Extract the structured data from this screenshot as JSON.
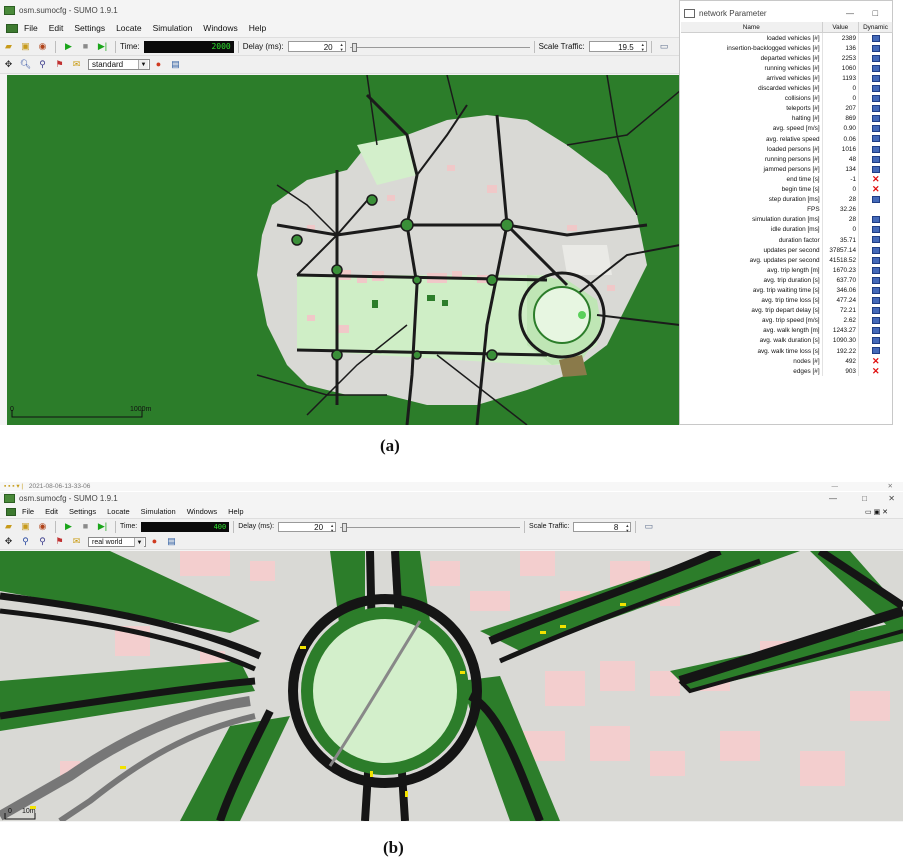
{
  "colors": {
    "grass": "#2c7d2a",
    "road": "#1b1b1b",
    "landuse": "#d6d6d2",
    "park": "#cfeec6",
    "building": "#f0c8c8",
    "time_text": "#2de02d",
    "dyn_plot": "#4469b8",
    "dyn_x": "#e01010"
  },
  "panel_a": {
    "title": "osm.sumocfg - SUMO 1.9.1",
    "menu": [
      "File",
      "Edit",
      "Settings",
      "Locate",
      "Simulation",
      "Windows",
      "Help"
    ],
    "toolbar": {
      "time_label": "Time:",
      "time_value": "2000",
      "delay_label": "Delay (ms):",
      "delay_value": "20",
      "scale_label": "Scale Traffic:",
      "scale_value": "19.5"
    },
    "view_selector": "standard",
    "scale_bar": {
      "start": "0",
      "end": "1000m"
    },
    "icons": [
      "open-icon",
      "reload-icon",
      "close-icon",
      "play-icon",
      "stop-icon",
      "step-icon",
      "locate-icon",
      "zoom-icon",
      "vehicle-locate-icon",
      "lock-icon",
      "speech-icon",
      "color-wheel-icon",
      "screenshot-icon"
    ]
  },
  "param_window": {
    "title": "network Parameter",
    "columns": [
      "Name",
      "Value",
      "Dynamic"
    ],
    "rows": [
      {
        "name": "loaded vehicles [#]",
        "value": "2389",
        "dyn": "plot"
      },
      {
        "name": "insertion-backlogged vehicles [#]",
        "value": "136",
        "dyn": "plot"
      },
      {
        "name": "departed vehicles [#]",
        "value": "2253",
        "dyn": "plot"
      },
      {
        "name": "running vehicles [#]",
        "value": "1060",
        "dyn": "plot"
      },
      {
        "name": "arrived vehicles [#]",
        "value": "1193",
        "dyn": "plot"
      },
      {
        "name": "discarded vehicles [#]",
        "value": "0",
        "dyn": "plot"
      },
      {
        "name": "collisions [#]",
        "value": "0",
        "dyn": "plot"
      },
      {
        "name": "teleports [#]",
        "value": "207",
        "dyn": "plot"
      },
      {
        "name": "halting [#]",
        "value": "869",
        "dyn": "plot"
      },
      {
        "name": "avg. speed [m/s]",
        "value": "0.90",
        "dyn": "plot"
      },
      {
        "name": "avg. relative speed",
        "value": "0.06",
        "dyn": "plot"
      },
      {
        "name": "loaded persons [#]",
        "value": "1016",
        "dyn": "plot"
      },
      {
        "name": "running persons [#]",
        "value": "48",
        "dyn": "plot"
      },
      {
        "name": "jammed persons [#]",
        "value": "134",
        "dyn": "plot"
      },
      {
        "name": "end time [s]",
        "value": "-1",
        "dyn": "x"
      },
      {
        "name": "begin time [s]",
        "value": "0",
        "dyn": "x"
      },
      {
        "name": "step duration [ms]",
        "value": "28",
        "dyn": "plot"
      },
      {
        "name": "FPS",
        "value": "32.26",
        "dyn": "none"
      },
      {
        "name": "simulation duration [ms]",
        "value": "28",
        "dyn": "plot"
      },
      {
        "name": "idle duration [ms]",
        "value": "0",
        "dyn": "plot"
      },
      {
        "name": "duration factor",
        "value": "35.71",
        "dyn": "plot"
      },
      {
        "name": "updates per second",
        "value": "37857.14",
        "dyn": "plot"
      },
      {
        "name": "avg. updates per second",
        "value": "41518.52",
        "dyn": "plot"
      },
      {
        "name": "avg. trip length [m]",
        "value": "1670.23",
        "dyn": "plot"
      },
      {
        "name": "avg. trip duration [s]",
        "value": "637.70",
        "dyn": "plot"
      },
      {
        "name": "avg. trip waiting time [s]",
        "value": "346.06",
        "dyn": "plot"
      },
      {
        "name": "avg. trip time loss [s]",
        "value": "477.24",
        "dyn": "plot"
      },
      {
        "name": "avg. trip depart delay [s]",
        "value": "72.21",
        "dyn": "plot"
      },
      {
        "name": "avg. trip speed [m/s]",
        "value": "2.62",
        "dyn": "plot"
      },
      {
        "name": "avg. walk length [m]",
        "value": "1243.27",
        "dyn": "plot"
      },
      {
        "name": "avg. walk duration [s]",
        "value": "1090.30",
        "dyn": "plot"
      },
      {
        "name": "avg. walk time loss [s]",
        "value": "192.22",
        "dyn": "plot"
      },
      {
        "name": "nodes [#]",
        "value": "492",
        "dyn": "x"
      },
      {
        "name": "edges [#]",
        "value": "903",
        "dyn": "x"
      }
    ]
  },
  "panel_b": {
    "taskbar_text": "2021-08-06-13-33-06",
    "title": "osm.sumocfg - SUMO 1.9.1",
    "menu": [
      "File",
      "Edit",
      "Settings",
      "Locate",
      "Simulation",
      "Windows",
      "Help"
    ],
    "toolbar": {
      "time_label": "Time:",
      "time_value": "400",
      "delay_label": "Delay (ms):",
      "delay_value": "20",
      "scale_label": "Scale Traffic:",
      "scale_value": "8"
    },
    "view_selector": "real world",
    "scale_bar": {
      "start": "0",
      "end": "10m"
    }
  },
  "captions": {
    "a": "(a)",
    "b": "(b)"
  },
  "window_controls": {
    "minimize": "—",
    "maximize": "□",
    "close": "✕"
  }
}
